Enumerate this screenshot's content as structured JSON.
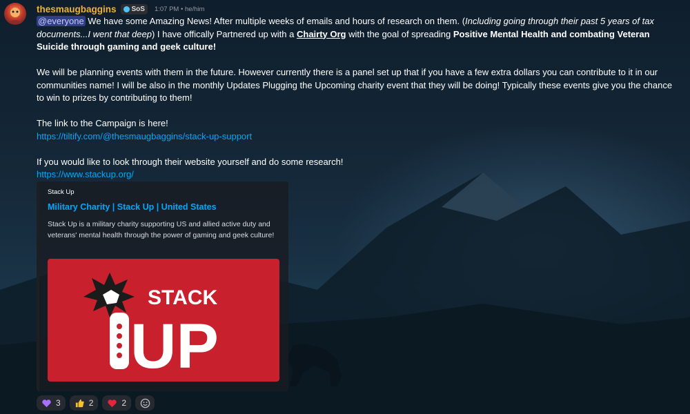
{
  "message": {
    "username": "thesmaugbaggins",
    "tag": "SoS",
    "timestamp": "1:07 PM • he/him",
    "mention": "@everyone",
    "p1_text1": " We have some Amazing News! After multiple weeks of emails and hours of research on them. (",
    "p1_italic": "Including going through their past 5 years of tax documents...I went that deep",
    "p1_text2": ")  I have offically Partnered up with a ",
    "p1_link": "Chairty Org",
    "p1_text3": " with the goal of spreading ",
    "p1_bold": "Positive Mental Health and combating Veteran Suicide through gaming and geek culture!",
    "p2": " We will be planning events with them in the future. However currently there is a panel set up that if you have a few extra dollars you can contribute to it in our communities name! I will be also in the monthly Updates Plugging the Upcoming charity event that they will be doing! Typically these events give you the chance to win to prizes by contributing to them!",
    "p3": "The link to the Campaign is here!",
    "link1": "https://tiltify.com/@thesmaugbaggins/stack-up-support",
    "p4": "If you would like to look through their website yourself and do some research!",
    "link2": "https://www.stackup.org/"
  },
  "embed": {
    "provider": "Stack Up",
    "title": "Military Charity | Stack Up | United States",
    "description": "Stack Up is a military charity supporting US and allied active duty and veterans' mental health through the power of gaming and geek culture!",
    "logo_top": "STACK",
    "logo_bottom": "UP",
    "image_bg": "#c8202c"
  },
  "reactions": [
    {
      "icon": "purple-heart-icon",
      "count": "3"
    },
    {
      "icon": "thumbs-up-icon",
      "count": "2"
    },
    {
      "icon": "red-heart-icon",
      "count": "2"
    }
  ],
  "colors": {
    "username": "#f0b232",
    "link": "#00a8fc",
    "mention_bg": "#5865f2"
  }
}
